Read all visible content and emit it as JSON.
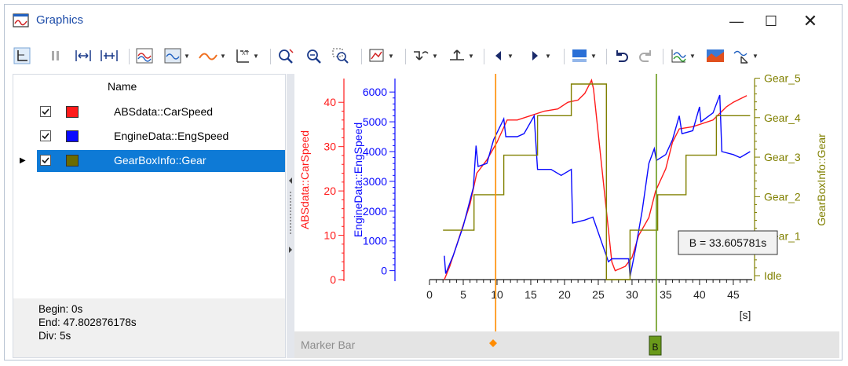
{
  "window": {
    "title": "Graphics"
  },
  "list": {
    "header": "Name",
    "rows": [
      {
        "label": "ABSdata::CarSpeed",
        "color": "#ff1a1a",
        "checked": true
      },
      {
        "label": "EngineData::EngSpeed",
        "color": "#0a0aff",
        "checked": true
      },
      {
        "label": "GearBoxInfo::Gear",
        "color": "#6b6b00",
        "checked": true,
        "selected": true
      }
    ]
  },
  "info": {
    "begin": "Begin: 0s",
    "end": "End: 47.802876178s",
    "div": "Div: 5s"
  },
  "chart_data": {
    "type": "line",
    "x_label": "[s]",
    "x_ticks": [
      "0",
      "5",
      "10",
      "15",
      "20",
      "25",
      "30",
      "35",
      "40",
      "45"
    ],
    "xlim": [
      0,
      47.8
    ],
    "series": [
      {
        "name": "ABSdata::CarSpeed",
        "color": "#ff1a1a",
        "axis_ticks": [
          "0",
          "10",
          "20",
          "30",
          "40"
        ],
        "ylim": [
          0,
          45
        ],
        "points": [
          [
            2.2,
            0
          ],
          [
            3,
            3
          ],
          [
            4.5,
            10
          ],
          [
            6,
            17
          ],
          [
            7,
            24
          ],
          [
            8.5,
            27
          ],
          [
            10,
            31
          ],
          [
            11.5,
            36
          ],
          [
            13,
            36
          ],
          [
            15,
            37
          ],
          [
            17,
            38
          ],
          [
            19,
            38.5
          ],
          [
            20.5,
            40
          ],
          [
            22,
            40.5
          ],
          [
            23,
            42
          ],
          [
            24,
            45
          ],
          [
            24.3,
            43
          ],
          [
            27,
            4
          ],
          [
            27.5,
            2
          ],
          [
            29,
            3
          ],
          [
            30,
            5
          ],
          [
            31,
            10
          ],
          [
            32.5,
            14
          ],
          [
            33.5,
            20
          ],
          [
            35,
            25
          ],
          [
            36,
            31
          ],
          [
            37,
            34
          ],
          [
            39,
            34.5
          ],
          [
            42,
            36
          ],
          [
            44,
            39
          ],
          [
            45,
            40
          ],
          [
            47,
            41.5
          ]
        ]
      },
      {
        "name": "EngineData::EngSpeed",
        "color": "#0a0aff",
        "axis_ticks": [
          "0",
          "1000",
          "2000",
          "3000",
          "4000",
          "5000",
          "6000"
        ],
        "ylim": [
          -300,
          6400
        ],
        "points": [
          [
            2.2,
            500
          ],
          [
            2.4,
            -100
          ],
          [
            3.5,
            500
          ],
          [
            5,
            1500
          ],
          [
            6.5,
            2800
          ],
          [
            6.9,
            4200
          ],
          [
            7.2,
            3500
          ],
          [
            8.5,
            3600
          ],
          [
            9.5,
            4400
          ],
          [
            11,
            5100
          ],
          [
            11.3,
            4500
          ],
          [
            13,
            4500
          ],
          [
            14,
            4600
          ],
          [
            15.5,
            5200
          ],
          [
            16,
            3400
          ],
          [
            18,
            3400
          ],
          [
            19.5,
            3200
          ],
          [
            21,
            3400
          ],
          [
            21.2,
            1600
          ],
          [
            23,
            1700
          ],
          [
            24.2,
            1800
          ],
          [
            26.5,
            300
          ],
          [
            27,
            400
          ],
          [
            29.5,
            400
          ],
          [
            29.7,
            -200
          ],
          [
            30.5,
            700
          ],
          [
            31.5,
            2000
          ],
          [
            32.5,
            3600
          ],
          [
            33.3,
            4100
          ],
          [
            33.6,
            3700
          ],
          [
            35,
            3900
          ],
          [
            36,
            4400
          ],
          [
            37,
            5200
          ],
          [
            37.4,
            4600
          ],
          [
            39,
            4700
          ],
          [
            40,
            5500
          ],
          [
            40.2,
            5000
          ],
          [
            42,
            5300
          ],
          [
            43,
            5900
          ],
          [
            43.3,
            4000
          ],
          [
            45,
            3900
          ],
          [
            46,
            3800
          ],
          [
            47.5,
            4000
          ]
        ]
      },
      {
        "name": "GearBoxInfo::Gear",
        "color": "#808000",
        "axis_ticks": [
          "Idle",
          "Gear_1",
          "Gear_2",
          "Gear_3",
          "Gear_4",
          "Gear_5"
        ],
        "ylim": [
          -0.1,
          4.95
        ],
        "points": [
          [
            2,
            1.15
          ],
          [
            6.6,
            1.15
          ],
          [
            6.6,
            2.05
          ],
          [
            11,
            2.05
          ],
          [
            11,
            3.05
          ],
          [
            16,
            3.05
          ],
          [
            16,
            4.05
          ],
          [
            21,
            4.05
          ],
          [
            21,
            4.85
          ],
          [
            26.2,
            4.85
          ],
          [
            26.2,
            -0.1
          ],
          [
            29.7,
            -0.1
          ],
          [
            29.7,
            1.15
          ],
          [
            33.8,
            1.15
          ],
          [
            33.8,
            2.05
          ],
          [
            38,
            2.05
          ],
          [
            38,
            3.05
          ],
          [
            42.5,
            3.05
          ],
          [
            42.5,
            4.05
          ],
          [
            47.5,
            4.05
          ]
        ]
      }
    ],
    "cursors": [
      {
        "x": 9.8,
        "color": "#ff8c00"
      },
      {
        "x": 33.605781,
        "color": "#6a9a1a",
        "label": "B"
      }
    ],
    "tooltip": "B = 33.605781s"
  },
  "marker_bar": {
    "label": "Marker Bar",
    "marker_b": "B"
  }
}
